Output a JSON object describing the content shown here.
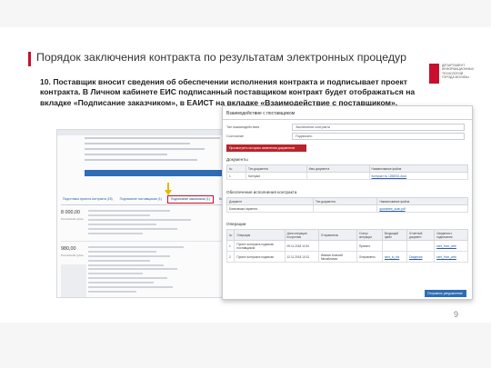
{
  "slide": {
    "title": "Порядок заключения контракта по результатам электронных процедур",
    "description": "10. Поставщик вносит сведения об обеспечении исполнения контракта и подписывает проект контракта. В Личном кабинете ЕИС подписанный поставщиком контракт будет отображаться на вкладке «Подписание заказчиком», в ЕАИСТ на вкладке «Взаимодействие с поставщиком».",
    "page_number": "9",
    "logo_lines": [
      "департамент",
      "информационных",
      "технологий",
      "города москвы"
    ],
    "accent_color": "#c8102e"
  },
  "eis_cabinet": {
    "tabs": [
      "Подготовка проекта контракта (18)",
      "Подписание поставщиком (1)",
      "Подписание заказчиком (1)",
      "Контракт заключен (2)"
    ],
    "highlighted_tab_index": 2,
    "prices": [
      "8 000,00",
      "980,00"
    ],
    "currency": "Российский рубль"
  },
  "interaction": {
    "title": "Взаимодействие с поставщиком",
    "fields": [
      {
        "label": "Тип взаимодействия",
        "value": "Заключение контракта"
      },
      {
        "label": "Состояние",
        "value": "Подписано"
      }
    ],
    "history_button": "Просмотреть историю изменения документов",
    "documents": {
      "heading": "Документы",
      "columns": [
        "№",
        "Тип документа",
        "Имя документа",
        "Наименование файла"
      ],
      "rows": [
        [
          "1",
          "Контракт",
          "",
          "Контракт № 1268001.docx"
        ]
      ]
    },
    "security": {
      "heading": "Обеспечение исполнения контракта",
      "columns": [
        "Документ",
        "Тип документа",
        "Наименование файла"
      ],
      "rows": [
        [
          "Банковская гарантия",
          "",
          "guarantee_scan.pdf"
        ]
      ]
    },
    "operations": {
      "heading": "Операции",
      "columns": [
        "№",
        "Операция",
        "Дата операции получения",
        "Отправитель",
        "Статус операции",
        "Входящий файл",
        "Отчетный документ",
        "Сведения о подписании"
      ],
      "rows": [
        [
          "1",
          "Проект контракта подписан поставщиком",
          "09.11.2018 11:54",
          "",
          "Принято",
          "",
          "",
          "sent_from_web"
        ],
        [
          "2",
          "Проект контракта подписан",
          "12.11.2018 10:31",
          "Иванов Алексей Михайлович",
          "Отправлено",
          "sent_to_eis",
          "Сведения",
          "sent_from_web"
        ]
      ]
    },
    "send_button": "Отправить уведомление"
  }
}
